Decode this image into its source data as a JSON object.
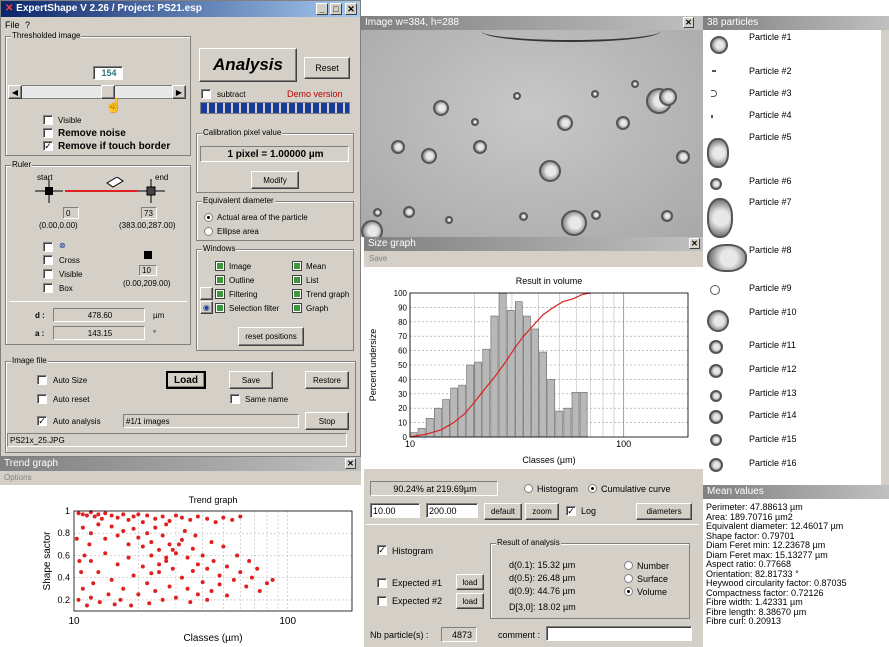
{
  "main_window": {
    "title": "ExpertShape V 2.26 / Project: PS21.esp",
    "menu": [
      "File",
      "?"
    ],
    "threshold": {
      "group": "Thresholded image",
      "value": "154",
      "visible": "Visible",
      "remove_noise": "Remove noise",
      "remove_touch": "Remove if touch border"
    },
    "analysis_button": "Analysis",
    "reset_button": "Reset",
    "subtract": "subtract",
    "demo": "Demo version",
    "calibration": {
      "group": "Calibration pixel value",
      "value": "1 pixel = 1.00000 µm",
      "modify": "Modify"
    },
    "equivalent": {
      "group": "Equivalent diameter",
      "opt1": "Actual area of the particle",
      "opt2": "Ellipse area"
    },
    "windows": {
      "group": "Windows",
      "items": [
        "Image",
        "Outline",
        "Filtering",
        "Selection filter",
        "Mean",
        "List",
        "Trend graph",
        "Graph"
      ],
      "reset": "reset positions"
    },
    "ruler": {
      "group": "Ruler",
      "start": "start",
      "end": "end",
      "start_val": "0",
      "start_coord": "(0.00,0.00)",
      "end_val": "73",
      "end_coord": "(383.00,287.00)",
      "cross": "Cross",
      "visible": "Visible",
      "box": "Box",
      "box_val": "10",
      "box_coord": "(0.00,209.00)",
      "d_label": "d :",
      "d_value": "478.60",
      "d_unit": "µm",
      "a_label": "a :",
      "a_value": "143.15",
      "a_unit": "°"
    },
    "image_file": {
      "group": "Image file",
      "auto_size": "Auto Size",
      "load": "Load",
      "save": "Save",
      "restore": "Restore",
      "auto_reset": "Auto reset",
      "same_name": "Same name",
      "auto_analysis": "Auto analysis",
      "images": "#1/1 images",
      "stop": "Stop",
      "filename": "PS21x_25.JPG"
    }
  },
  "image_window": {
    "title": "Image w=384, h=288"
  },
  "particles_window": {
    "title": "38 particles",
    "items": [
      "Particle #1",
      "Particle #2",
      "Particle #3",
      "Particle #4",
      "Particle #5",
      "Particle #6",
      "Particle #7",
      "Particle #8",
      "Particle #9",
      "Particle #10",
      "Particle #11",
      "Particle #12",
      "Particle #13",
      "Particle #14",
      "Particle #15",
      "Particle #16"
    ]
  },
  "size_graph": {
    "title": "Size graph",
    "menu": "Save",
    "stat": "90.24% at 219.69µm",
    "histogram_opt": "Histogram",
    "cumulative_opt": "Cumulative curve",
    "min": "10.00",
    "max": "200.00",
    "default_btn": "default",
    "zoom_btn": "zoom",
    "log": "Log",
    "diameters_btn": "diameters",
    "histogram_chk": "Histogram",
    "expected1": "Expected #1",
    "expected2": "Expected #2",
    "load": "load",
    "result_group": "Result of analysis",
    "d01": "d(0.1): 15.32 µm",
    "d05": "d(0.5): 26.48 µm",
    "d09": "d(0.9): 44.76 µm",
    "d30": "D[3,0]: 18.02 µm",
    "number": "Number",
    "surface": "Surface",
    "volume": "Volume",
    "nb_label": "Nb particle(s) :",
    "nb_value": "4873",
    "comment_label": "comment :"
  },
  "chart_data": [
    {
      "type": "bar",
      "title": "Result in volume",
      "xlabel": "Classes (µm)",
      "ylabel": "Percent undersize",
      "xscale": "log",
      "xlim": [
        10,
        200
      ],
      "ylim": [
        0,
        100
      ],
      "xticks": [
        "10",
        "100"
      ],
      "yticks": [
        "0",
        "10",
        "20",
        "30",
        "40",
        "50",
        "60",
        "70",
        "80",
        "90",
        "100"
      ],
      "bins": [
        {
          "x0": 10.0,
          "x1": 10.9,
          "v": 3
        },
        {
          "x0": 10.9,
          "x1": 11.9,
          "v": 6
        },
        {
          "x0": 11.9,
          "x1": 13.0,
          "v": 13
        },
        {
          "x0": 13.0,
          "x1": 14.2,
          "v": 20
        },
        {
          "x0": 14.2,
          "x1": 15.5,
          "v": 26
        },
        {
          "x0": 15.5,
          "x1": 16.9,
          "v": 34
        },
        {
          "x0": 16.9,
          "x1": 18.4,
          "v": 36
        },
        {
          "x0": 18.4,
          "x1": 20.1,
          "v": 50
        },
        {
          "x0": 20.1,
          "x1": 21.9,
          "v": 52
        },
        {
          "x0": 21.9,
          "x1": 23.9,
          "v": 61
        },
        {
          "x0": 23.9,
          "x1": 26.1,
          "v": 84
        },
        {
          "x0": 26.1,
          "x1": 28.5,
          "v": 100
        },
        {
          "x0": 28.5,
          "x1": 31.1,
          "v": 88
        },
        {
          "x0": 31.1,
          "x1": 33.9,
          "v": 94
        },
        {
          "x0": 33.9,
          "x1": 37.0,
          "v": 84
        },
        {
          "x0": 37.0,
          "x1": 40.4,
          "v": 75
        },
        {
          "x0": 40.4,
          "x1": 44.1,
          "v": 59
        },
        {
          "x0": 44.1,
          "x1": 48.1,
          "v": 40
        },
        {
          "x0": 48.1,
          "x1": 52.5,
          "v": 18
        },
        {
          "x0": 52.5,
          "x1": 57.3,
          "v": 20
        },
        {
          "x0": 57.3,
          "x1": 62.5,
          "v": 31
        },
        {
          "x0": 62.5,
          "x1": 68.2,
          "v": 31
        }
      ],
      "cumulative_curve": {
        "x": [
          10,
          12,
          14,
          16,
          18,
          20,
          22,
          25,
          28,
          31,
          34,
          38,
          42,
          47,
          52,
          58,
          64,
          70
        ],
        "y": [
          0,
          2,
          5,
          10,
          16,
          24,
          32,
          42,
          52,
          62,
          70,
          78,
          85,
          90,
          94,
          96,
          99,
          100
        ]
      }
    },
    {
      "type": "scatter",
      "title": "Trend graph",
      "xlabel": "Classes (µm)",
      "ylabel": "Shape sactor",
      "xscale": "log",
      "xlim": [
        10,
        200
      ],
      "ylim": [
        0.1,
        1.0
      ],
      "xticks": [
        "10",
        "100"
      ],
      "yticks": [
        "0.2",
        "0.4",
        "0.6",
        "0.8",
        "1"
      ],
      "points": [
        [
          10.5,
          0.98
        ],
        [
          11,
          0.97
        ],
        [
          11.5,
          0.96
        ],
        [
          12,
          0.99
        ],
        [
          12.5,
          0.95
        ],
        [
          13,
          0.97
        ],
        [
          13.5,
          0.93
        ],
        [
          14,
          0.98
        ],
        [
          15,
          0.96
        ],
        [
          16,
          0.94
        ],
        [
          17,
          0.97
        ],
        [
          18,
          0.92
        ],
        [
          19,
          0.95
        ],
        [
          20,
          0.97
        ],
        [
          21,
          0.9
        ],
        [
          22,
          0.96
        ],
        [
          24,
          0.93
        ],
        [
          26,
          0.95
        ],
        [
          28,
          0.91
        ],
        [
          30,
          0.96
        ],
        [
          32,
          0.94
        ],
        [
          35,
          0.92
        ],
        [
          38,
          0.95
        ],
        [
          42,
          0.93
        ],
        [
          46,
          0.9
        ],
        [
          50,
          0.94
        ],
        [
          55,
          0.92
        ],
        [
          60,
          0.95
        ],
        [
          11,
          0.85
        ],
        [
          12,
          0.8
        ],
        [
          13,
          0.88
        ],
        [
          14,
          0.75
        ],
        [
          15,
          0.86
        ],
        [
          16,
          0.78
        ],
        [
          17,
          0.82
        ],
        [
          18,
          0.7
        ],
        [
          19,
          0.84
        ],
        [
          20,
          0.76
        ],
        [
          21,
          0.68
        ],
        [
          22,
          0.8
        ],
        [
          23,
          0.72
        ],
        [
          24,
          0.85
        ],
        [
          25,
          0.65
        ],
        [
          26,
          0.78
        ],
        [
          28,
          0.7
        ],
        [
          30,
          0.62
        ],
        [
          32,
          0.74
        ],
        [
          34,
          0.58
        ],
        [
          36,
          0.66
        ],
        [
          38,
          0.52
        ],
        [
          40,
          0.6
        ],
        [
          42,
          0.48
        ],
        [
          45,
          0.55
        ],
        [
          48,
          0.42
        ],
        [
          52,
          0.5
        ],
        [
          56,
          0.38
        ],
        [
          60,
          0.45
        ],
        [
          64,
          0.32
        ],
        [
          68,
          0.4
        ],
        [
          74,
          0.28
        ],
        [
          80,
          0.35
        ],
        [
          12,
          0.55
        ],
        [
          13,
          0.45
        ],
        [
          14,
          0.62
        ],
        [
          15,
          0.38
        ],
        [
          16,
          0.52
        ],
        [
          17,
          0.3
        ],
        [
          18,
          0.58
        ],
        [
          19,
          0.42
        ],
        [
          20,
          0.25
        ],
        [
          21,
          0.5
        ],
        [
          22,
          0.35
        ],
        [
          23,
          0.6
        ],
        [
          24,
          0.28
        ],
        [
          25,
          0.45
        ],
        [
          26,
          0.2
        ],
        [
          27,
          0.55
        ],
        [
          28,
          0.32
        ],
        [
          29,
          0.48
        ],
        [
          30,
          0.22
        ],
        [
          32,
          0.4
        ],
        [
          34,
          0.3
        ],
        [
          36,
          0.46
        ],
        [
          38,
          0.25
        ],
        [
          40,
          0.36
        ],
        [
          44,
          0.28
        ],
        [
          48,
          0.34
        ],
        [
          52,
          0.24
        ],
        [
          10.5,
          0.2
        ],
        [
          11,
          0.3
        ],
        [
          11.5,
          0.15
        ],
        [
          12,
          0.22
        ],
        [
          10.8,
          0.45
        ],
        [
          11.2,
          0.6
        ],
        [
          11.8,
          0.7
        ],
        [
          12.3,
          0.35
        ],
        [
          10.3,
          0.75
        ],
        [
          10.6,
          0.55
        ],
        [
          13.2,
          0.18
        ],
        [
          14.5,
          0.25
        ],
        [
          15.5,
          0.16
        ],
        [
          16.5,
          0.2
        ],
        [
          18.5,
          0.15
        ],
        [
          22.5,
          0.17
        ],
        [
          35,
          0.18
        ],
        [
          42,
          0.2
        ],
        [
          27,
          0.88
        ],
        [
          33,
          0.82
        ],
        [
          37,
          0.78
        ],
        [
          44,
          0.72
        ],
        [
          50,
          0.68
        ],
        [
          58,
          0.6
        ],
        [
          66,
          0.55
        ],
        [
          72,
          0.48
        ],
        [
          85,
          0.38
        ],
        [
          31,
          0.7
        ],
        [
          29,
          0.65
        ],
        [
          27,
          0.58
        ],
        [
          25,
          0.52
        ],
        [
          23,
          0.44
        ]
      ]
    }
  ],
  "trend_window": {
    "title": "Trend graph",
    "menu": "Options"
  },
  "mean_values": {
    "title": "Mean values",
    "lines": [
      "Perimeter: 47.88613 µm",
      "Area: 189.70716 µm2",
      "Equivalent diameter: 12.46017 µm",
      "Shape factor: 0.79701",
      "Diam Feret min: 12.23678 µm",
      "Diam Feret max: 15.13277 µm",
      "Aspect ratio: 0.77668",
      "Orientation: 82.81733 °",
      "Heywood circularity factor: 0.87035",
      "Compactness factor: 0.72126",
      "Fibre width: 1.42331 µm",
      "Fibre length: 8.38670 µm",
      "Fibre curl: 0.20913"
    ]
  },
  "colors": {
    "title_active": "#0a246a",
    "bar": "#b8b8b8",
    "curve": "#dd2020",
    "scatter": "#e02020",
    "demo": "#c00000",
    "progress": "#1a3a9a"
  }
}
